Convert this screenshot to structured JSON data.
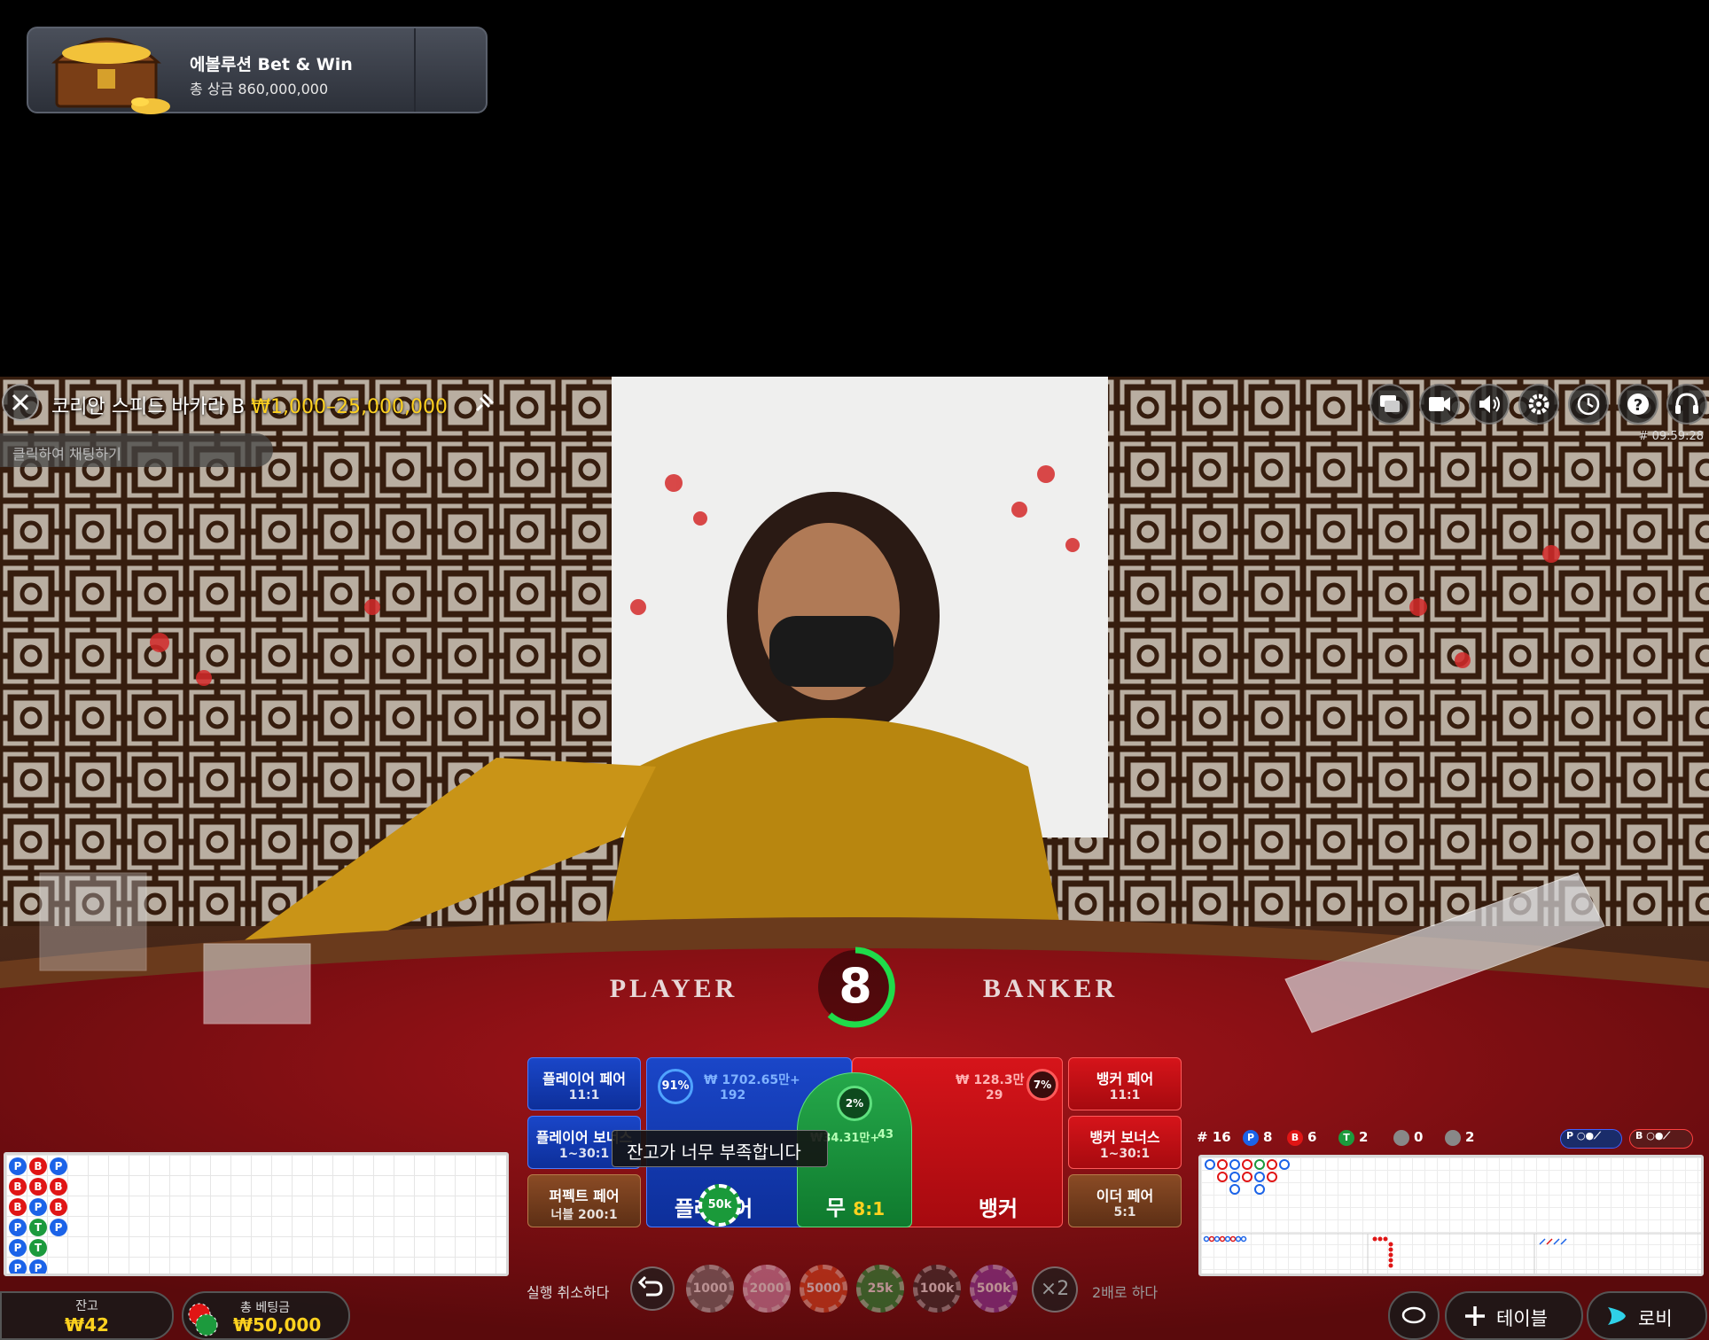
{
  "promo": {
    "title": "에볼루션 Bet & Win",
    "subtitle": "총 상금 860,000,000"
  },
  "header": {
    "table_name": "코리안 스피드 바카라 B",
    "limits": "₩1,000–25,000,000",
    "chat_placeholder": "클릭하여 채팅하기",
    "timecode": "# 09:59:28",
    "tools": [
      "chat-icon",
      "video-icon",
      "sound-icon",
      "settings-icon",
      "history-icon",
      "help-icon",
      "lobby-headset-icon"
    ]
  },
  "table_felt": {
    "player": "PLAYER",
    "banker": "BANKER"
  },
  "countdown": "8",
  "bets": {
    "player_pair": {
      "label": "플레이어 페어",
      "odds": "11:1"
    },
    "player_bonus": {
      "label": "플레이어 보너스",
      "odds": "1~30:1"
    },
    "perfect_pair": {
      "label": "퍼펙트 페어",
      "odds": "너블 200:1"
    },
    "player": {
      "label": "플레이어",
      "percent": "91%",
      "amount": "₩ 1702.65만+",
      "players": "192",
      "chip": "50k"
    },
    "tie": {
      "label": "무",
      "odds": "8:1",
      "percent": "2%",
      "amount": "₩34.31만+",
      "players": "43"
    },
    "banker": {
      "label": "뱅커",
      "percent": "7%",
      "amount": "₩ 128.3만",
      "players": "29"
    },
    "banker_pair": {
      "label": "뱅커 페어",
      "odds": "11:1"
    },
    "banker_bonus": {
      "label": "뱅커 보너스",
      "odds": "1~30:1"
    },
    "either_pair": {
      "label": "이더 페어",
      "odds": "5:1"
    }
  },
  "tooltip": "잔고가 너무 부족합니다",
  "bead_road": [
    [
      "P",
      "B",
      "P"
    ],
    [
      "B",
      "B",
      "B"
    ],
    [
      "B",
      "P",
      "B"
    ],
    [
      "P",
      "T",
      "P"
    ],
    [
      "P",
      "T"
    ],
    [
      "P",
      "P"
    ]
  ],
  "stats": {
    "round": "# 16",
    "player_count": "8",
    "banker_count": "6",
    "tie_count": "2",
    "player_pair_count": "0",
    "banker_pair_count": "2",
    "p_label": "P",
    "b_label": "B",
    "t_label": "T"
  },
  "controls": {
    "undo_label": "실행 취소하다",
    "chips": [
      "1000",
      "2000",
      "5000",
      "25k",
      "100k",
      "500k"
    ],
    "double_symbol": "×2",
    "double_label": "2배로 하다"
  },
  "footer": {
    "balance_label": "잔고",
    "balance_value": "₩42",
    "total_bet_label": "총 베팅금",
    "total_bet_value": "₩50,000",
    "table_button": "테이블",
    "lobby_button": "로비"
  }
}
